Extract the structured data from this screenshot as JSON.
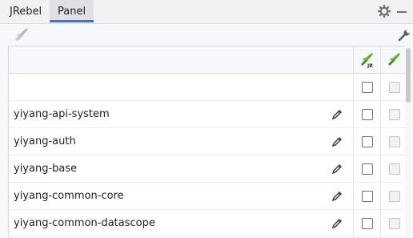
{
  "tabs": [
    {
      "label": "JRebel",
      "active": false
    },
    {
      "label": "Panel",
      "active": true
    }
  ],
  "toolbar": {
    "left_icon": "jrebel-rocket-icon",
    "right_icon": "wrench-icon"
  },
  "header_icons": [
    "jrebel-rocket-jr-icon",
    "jrebel-remote-rocket-icon"
  ],
  "rows": [
    {
      "name": ""
    },
    {
      "name": "yiyang-api-system"
    },
    {
      "name": "yiyang-auth"
    },
    {
      "name": "yiyang-base"
    },
    {
      "name": "yiyang-common-core"
    },
    {
      "name": "yiyang-common-datascope"
    }
  ],
  "colors": {
    "accent": "#3574f0",
    "rocket_green": "#5fb832"
  }
}
